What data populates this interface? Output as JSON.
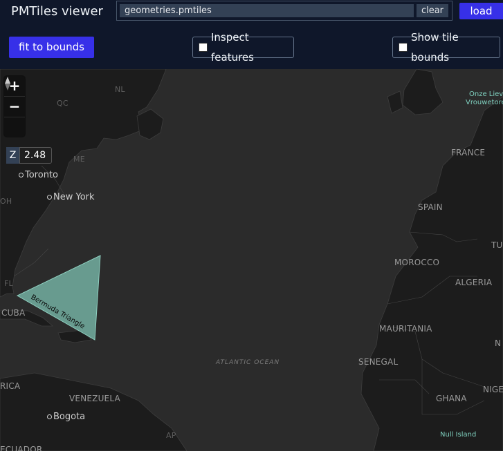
{
  "app": {
    "title": "PMTiles viewer"
  },
  "url_bar": {
    "value": "geometries.pmtiles",
    "clear_label": "clear",
    "load_label": "load"
  },
  "controls": {
    "fit_label": "fit to bounds",
    "inspect_label": "Inspect features",
    "inspect_checked": false,
    "tile_bounds_label": "Show tile bounds",
    "tile_bounds_checked": false
  },
  "map": {
    "zoom_in": "+",
    "zoom_out": "−",
    "zoom_label": "Z",
    "zoom_value": "2.48",
    "feature_label": "Bermuda Triangle",
    "ocean_label": "ATLANTIC OCEAN",
    "cities": [
      "Toronto",
      "New York",
      "Bogota"
    ],
    "countries": [
      "FRANCE",
      "SPAIN",
      "MOROCCO",
      "ALGERIA",
      "MAURITANIA",
      "SENEGAL",
      "GHANA",
      "CUBA",
      "VENEZUELA"
    ],
    "partial_labels": [
      "NL",
      "QC",
      "ME",
      "OH",
      "FL",
      "RICA",
      "ECUADOR",
      "NIGE",
      "N",
      "TU",
      "AP"
    ],
    "places": [
      "Onze Lieve",
      "Vrouwetore",
      "Null Island"
    ],
    "colors": {
      "feature_fill": "#6fa79a",
      "land": "#1c1c1c",
      "water": "#2b2b2b",
      "accent": "#3730e8"
    }
  }
}
